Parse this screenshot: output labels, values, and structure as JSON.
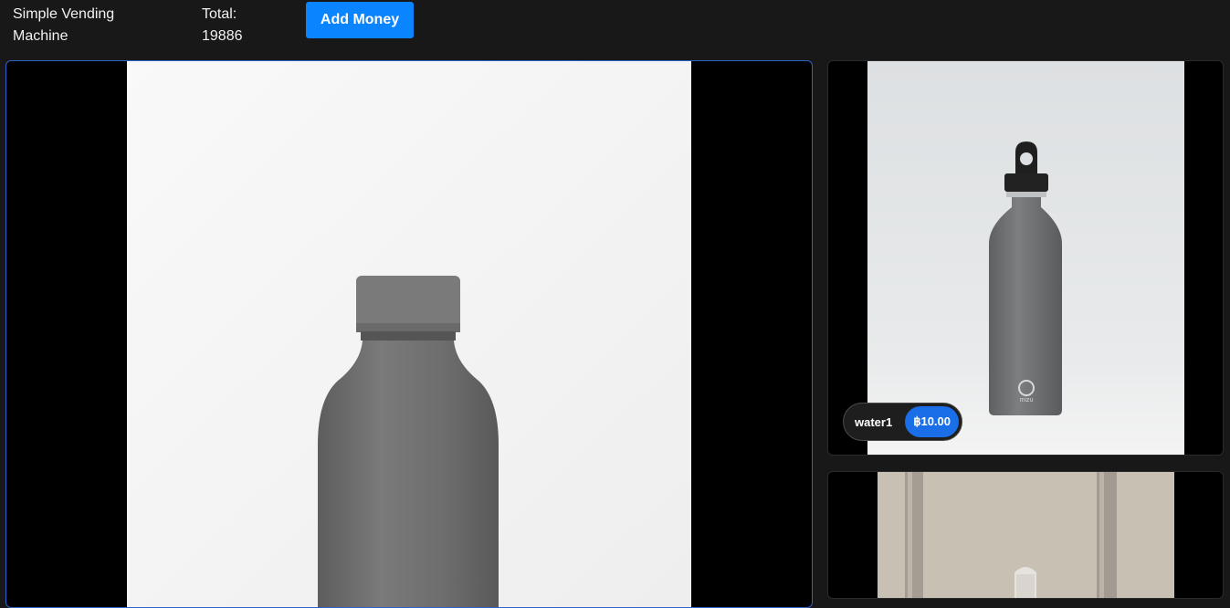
{
  "header": {
    "app_title": "Simple Vending Machine",
    "total_label": "Total:",
    "total_value": "19886",
    "add_money_label": "Add Money"
  },
  "products": [
    {
      "name": "water1",
      "price": "฿10.00"
    }
  ],
  "colors": {
    "accent": "#0a84ff",
    "price_badge": "#1a6fe8",
    "background": "#181818",
    "selected_border": "#2d63c8"
  }
}
